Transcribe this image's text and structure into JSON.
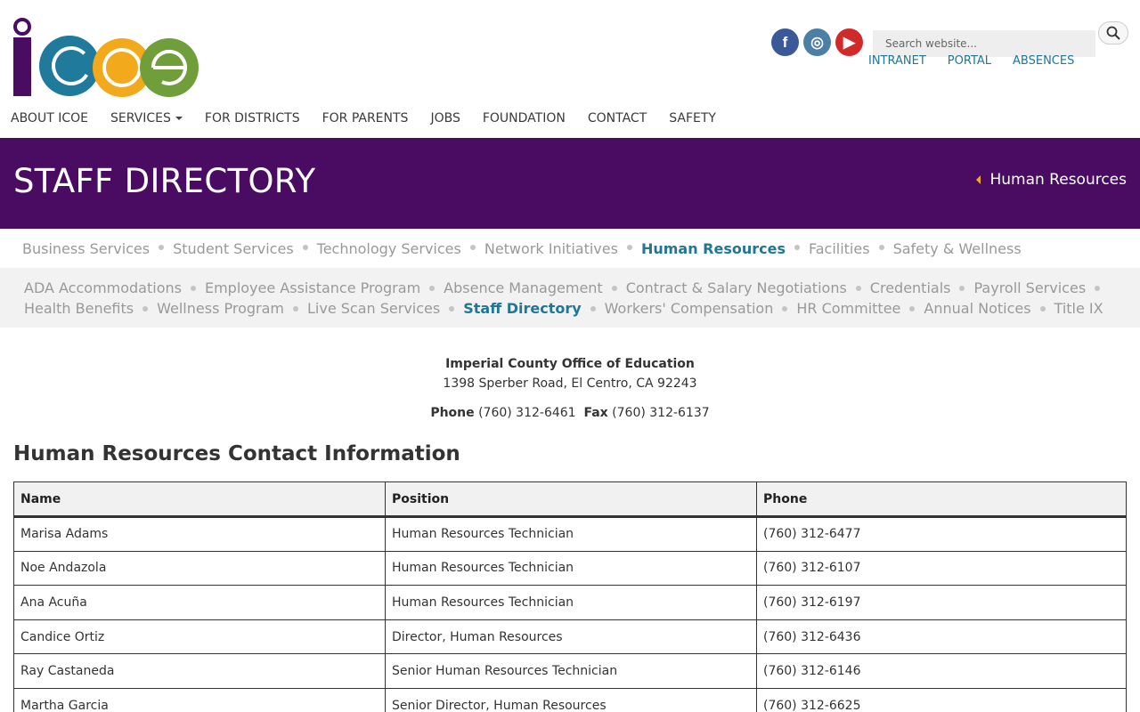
{
  "header": {
    "logo_alt": "icoe",
    "social": [
      {
        "name": "facebook",
        "glyph": "f",
        "icon": "facebook-icon"
      },
      {
        "name": "instagram",
        "glyph": "◎",
        "icon": "instagram-icon"
      },
      {
        "name": "youtube",
        "glyph": "▶",
        "icon": "youtube-icon"
      }
    ],
    "search_placeholder": "Search website...",
    "quick_links": [
      "INTRANET",
      "PORTAL",
      "ABSENCES"
    ],
    "nav": [
      "ABOUT ICOE",
      "SERVICES",
      "FOR DISTRICTS",
      "FOR PARENTS",
      "JOBS",
      "FOUNDATION",
      "CONTACT",
      "SAFETY"
    ]
  },
  "banner": {
    "title": "STAFF DIRECTORY",
    "breadcrumb": "Human Resources"
  },
  "subnav_primary": [
    {
      "label": "Business Services",
      "active": false
    },
    {
      "label": "Student Services",
      "active": false
    },
    {
      "label": "Technology Services",
      "active": false
    },
    {
      "label": "Network Initiatives",
      "active": false
    },
    {
      "label": "Human Resources",
      "active": true
    },
    {
      "label": "Facilities",
      "active": false
    },
    {
      "label": "Safety & Wellness",
      "active": false
    }
  ],
  "subnav_secondary": [
    {
      "label": "ADA Accommodations",
      "active": false
    },
    {
      "label": "Employee Assistance Program",
      "active": false
    },
    {
      "label": "Absence Management",
      "active": false
    },
    {
      "label": "Contract & Salary Negotiations",
      "active": false
    },
    {
      "label": "Credentials",
      "active": false
    },
    {
      "label": "Payroll Services",
      "active": false
    },
    {
      "label": "Health Benefits",
      "active": false
    },
    {
      "label": "Wellness Program",
      "active": false
    },
    {
      "label": "Live Scan Services",
      "active": false
    },
    {
      "label": "Staff Directory",
      "active": true
    },
    {
      "label": "Workers' Compensation",
      "active": false
    },
    {
      "label": "HR Committee",
      "active": false
    },
    {
      "label": "Annual Notices",
      "active": false
    },
    {
      "label": "Title IX",
      "active": false
    }
  ],
  "address": {
    "org": "Imperial County Office of Education",
    "street": "1398 Sperber Road, El Centro, CA 92243",
    "phone_label": "Phone",
    "phone": "(760) 312-6461",
    "fax_label": "Fax",
    "fax": "(760) 312-6137"
  },
  "section_title": "Human Resources Contact Information",
  "table": {
    "headers": [
      "Name",
      "Position",
      "Phone"
    ],
    "rows": [
      [
        "Marisa Adams",
        "Human Resources Technician",
        "(760) 312-6477"
      ],
      [
        "Noe Andazola",
        "Human Resources Technician",
        "(760) 312-6107"
      ],
      [
        "Ana Acuña",
        "Human Resources Technician",
        "(760) 312-6197"
      ],
      [
        "Candice Ortiz",
        "Director, Human Resources",
        "(760) 312-6436"
      ],
      [
        "Ray Castaneda",
        "Senior Human Resources Technician",
        "(760) 312-6146"
      ],
      [
        "Martha Garcia",
        "Senior Director, Human Resources",
        "(760) 312-6625"
      ]
    ]
  },
  "colors": {
    "banner": "#4a0c63",
    "link_active": "#217696",
    "logo_purple": "#4a0c63",
    "logo_blue": "#1f7a9c",
    "logo_orange": "#f2a91c",
    "logo_green": "#6f9e3b"
  }
}
